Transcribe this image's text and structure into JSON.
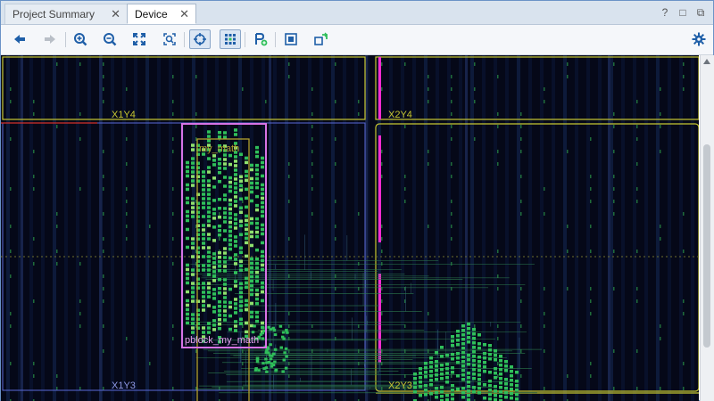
{
  "tabs": [
    {
      "label": "Project Summary",
      "active": false
    },
    {
      "label": "Device",
      "active": true
    }
  ],
  "window_controls": {
    "help": "?",
    "restore": "□",
    "float": "⧉"
  },
  "toolbar": {
    "buttons": [
      {
        "name": "back",
        "icon": "arrow-left-icon"
      },
      {
        "name": "forward",
        "icon": "arrow-right-icon"
      },
      {
        "name": "zoom-in",
        "icon": "zoom-in-icon"
      },
      {
        "name": "zoom-out",
        "icon": "zoom-out-icon"
      },
      {
        "name": "zoom-fit",
        "icon": "fit-icon"
      },
      {
        "name": "zoom-selected",
        "icon": "zoom-selected-icon"
      },
      {
        "name": "auto-fit-selection",
        "icon": "crosshair-icon",
        "pressed": true
      },
      {
        "name": "routing-resources",
        "icon": "routing-icon",
        "pressed": true
      },
      {
        "name": "draw-pblock",
        "icon": "pblock-add-icon"
      },
      {
        "name": "io-planning",
        "icon": "io-icon"
      },
      {
        "name": "site-constraint",
        "icon": "site-icon"
      },
      {
        "name": "settings",
        "icon": "gear-icon"
      }
    ]
  },
  "device": {
    "clock_regions": [
      {
        "label": "X1Y4"
      },
      {
        "label": "X2Y4"
      },
      {
        "label": "X1Y3"
      },
      {
        "label": "X2Y3"
      }
    ],
    "pblock_label": "pblock_my_math",
    "instance_label": "my_math"
  },
  "colors": {
    "canvas_bg": "#050818",
    "region_border": "#c8c832",
    "pblock": "#d873e6",
    "cell": "#2fbf5a",
    "accent": "#1f5fa8",
    "io_pin": "#ff2bd1"
  }
}
